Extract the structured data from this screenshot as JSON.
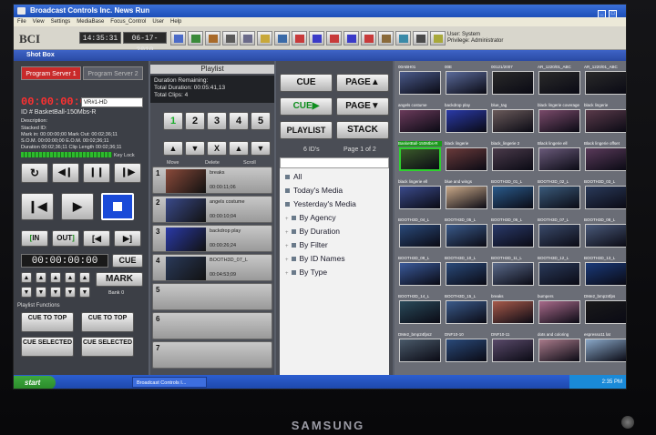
{
  "window": {
    "title": "Broadcast Controls Inc.   News Run"
  },
  "menu": [
    "File",
    "View",
    "Settings",
    "MediaBase",
    "Focus_Control",
    "User",
    "Help"
  ],
  "toolbar": {
    "logo": "BCI",
    "time": "14:35:31",
    "date": "06-17-2010",
    "user_label": "User: System",
    "privilege_label": "Privilege: Administrator",
    "tool_icons": [
      "gear-icon",
      "monitor-icon",
      "film-icon",
      "keyboard-icon",
      "grid-icon",
      "folder-icon",
      "display-icon",
      "flag-icon",
      "flag-icon",
      "flag-icon",
      "flag-icon",
      "flag-icon",
      "tools-icon",
      "screen-icon",
      "camera-icon",
      "pencil-icon"
    ]
  },
  "shotbox": {
    "label": "Shot Box"
  },
  "left": {
    "tab1": "Program Server 1",
    "tab2": "Program Server 2",
    "timecode": "00:00:00:01",
    "vr_select": "VR#1-HD",
    "clip_id": "ID # BasketBall-150Mbs-R",
    "description_label": "Description:",
    "details": [
      "Stacked ID:",
      "Mark in: 00:00:00;00   Mark Out: 00:02;36;11",
      "S.O.M. 00:00:00;00   E.O.M. 00:02;36;11",
      "Duration 00:02;36;11   Clip Length 00:02;36;11"
    ],
    "key_lock": "Key Lock",
    "in_label": "IN",
    "out_label": "OUT",
    "cue_time": "00:00:00:00",
    "cue_label": "CUE",
    "mark_label": "MARK",
    "bank_label": "Bank 0",
    "functions_label": "Playlist Functions",
    "cue_to_top": "CUE TO TOP",
    "cue_selected": "CUE SELECTED"
  },
  "playlist": {
    "title": "Playlist",
    "info": [
      "Duration Remaining:",
      "Total Duration: 00:05:41,13",
      "Total Clips: 4"
    ],
    "numbers": [
      "1",
      "2",
      "3",
      "4",
      "5"
    ],
    "controls": [
      "▲",
      "▼",
      "X",
      "▲",
      "▼"
    ],
    "labels": [
      "Move",
      "Delete",
      "Scroll"
    ],
    "slots": [
      {
        "n": "1",
        "title": "breaks",
        "dur": "00:00:11;06",
        "color": "#8a4a3a"
      },
      {
        "n": "2",
        "title": "angels costume",
        "dur": "00:00:10;04",
        "color": "#3a4a8a"
      },
      {
        "n": "3",
        "title": "backdrop play",
        "dur": "00:00:26;24",
        "color": "#2a3aa8"
      },
      {
        "n": "4",
        "title": "BOOTH3D_07_L",
        "dur": "00:04:53;09",
        "color": "#2a3a5a"
      },
      {
        "n": "5",
        "title": "",
        "dur": "",
        "color": ""
      },
      {
        "n": "6",
        "title": "",
        "dur": "",
        "color": ""
      },
      {
        "n": "7",
        "title": "",
        "dur": "",
        "color": ""
      }
    ]
  },
  "center": {
    "cue": "CUE",
    "cue_next": "CUE",
    "page_up": "PAGE",
    "page_down": "PAGE",
    "playlist_btn": "PLAYLIST",
    "stack_btn": "STACK",
    "ids_label": "6 ID's",
    "page_label": "Page 1 of 2",
    "tree": [
      "All",
      "Today's Media",
      "Yesterday's Media",
      "By Agency",
      "By Duration",
      "By Filter",
      "By ID Names",
      "By Type"
    ]
  },
  "grid": [
    [
      "00ABH01",
      "00E",
      "00121/2007",
      "AR_1220/01_ABC",
      "AR_1220/01_ABC"
    ],
    [
      "angels costume",
      "backdrop play",
      "blue_tag",
      "black lingerie coverage",
      "black lingerie"
    ],
    [
      "BasketBall-150Mbs-R",
      "black lingerie",
      "black_lingerie 2",
      "Black lingerie ell",
      "Black lingerie offset"
    ],
    [
      "black lingerie ell",
      "blue and wings",
      "BOOTH3D_01_L",
      "BOOTH3D_02_L",
      "BOOTH3D_03_L"
    ],
    [
      "BOOTH3D_04_L",
      "BOOTH3D_05_L",
      "BOOTH3D_06_L",
      "BOOTH3D_07_L",
      "BOOTH3D_08_L"
    ],
    [
      "BOOTH3D_09_L",
      "BOOTH3D_10_L",
      "BOOTH3D_11_L",
      "BOOTH3D_12_L",
      "BOOTH3D_13_L"
    ],
    [
      "BOOTH3D_14_L",
      "BOOTH3D_15_L",
      "breaks",
      "bumpers",
      "DMe2_bmp24fps"
    ],
    [
      "DMe2_bmp24fps2",
      "DNF10-10",
      "DNF10-11",
      "dots and coloring",
      "espresso11 lat"
    ]
  ],
  "grid_colors": [
    [
      "#4a5a8a",
      "#5a6a9a",
      "#2a2a2a",
      "#2a2a2a",
      "#2a2a2a"
    ],
    [
      "#6a3a5a",
      "#2a3aa8",
      "#6a5a5a",
      "#7a4a6a",
      "#5a3a4a"
    ],
    [
      "#3a5a2a",
      "#6a3a3a",
      "#4a3a4a",
      "#6a5a7a",
      "#5a3a5a"
    ],
    [
      "#3a4a8a",
      "#c8a888",
      "#2a5a8a",
      "#3a5a7a",
      "#2a3a5a"
    ],
    [
      "#2a4a7a",
      "#3a5a8a",
      "#2a3a6a",
      "#3a4a6a",
      "#4a5a7a"
    ],
    [
      "#3a5a9a",
      "#2a4a7a",
      "#5a6a8a",
      "#2a3a5a",
      "#1a3a7a"
    ],
    [
      "#2a4a5a",
      "#3a5a8a",
      "#a85a4a",
      "#a86a8a",
      "#1a1a1a"
    ],
    [
      "#4a5a6a",
      "#2a4a7a",
      "#5a4a6a",
      "#a87a8a",
      "#8aa8c8"
    ]
  ],
  "taskbar": {
    "start": "start",
    "task": "Broadcast Controls I...",
    "clock": "2:35 PM"
  },
  "monitor": {
    "brand": "SAMSUNG"
  }
}
